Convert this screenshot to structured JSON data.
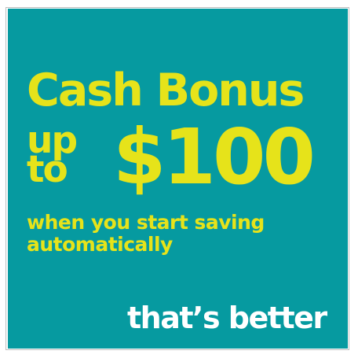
{
  "banner": {
    "background_color": "#069aa0",
    "accent_color": "#e6e31a",
    "headline": "Cash Bonus",
    "upto_line1": "up",
    "upto_line2": "to",
    "amount": "$100",
    "subline_1": "when you start saving",
    "subline_2": "automatically",
    "tagline": "that’s better"
  }
}
